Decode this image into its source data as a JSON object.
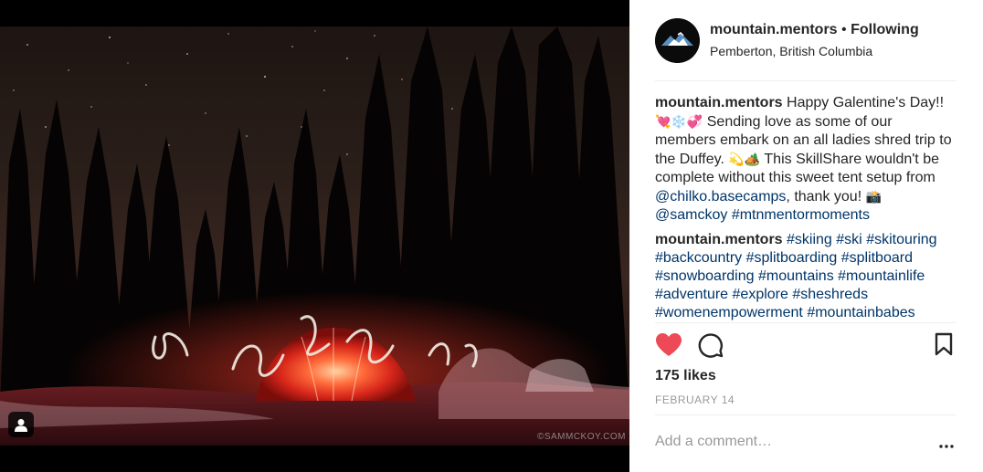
{
  "post": {
    "username": "mountain.mentors",
    "separator": "•",
    "follow_status": "Following",
    "location": "Pemberton, British Columbia",
    "photo_watermark": "©SAMMCKOY.COM"
  },
  "comments": [
    {
      "username": "mountain.mentors",
      "text_1": "Happy Galentine's Day!!",
      "emoji_1": "💘❄️💞",
      "text_2": "Sending love as some of our members embark on an all ladies shred trip to the Duffey.",
      "emoji_2": "💫🏕️",
      "text_3": "This SkillShare wouldn't be complete without this sweet tent setup from",
      "mention_1": "@chilko.basecamps",
      "text_4": ", thank you!",
      "emoji_3": "📸",
      "mention_2": "@samckoy",
      "hashtag_1": "#mtnmentormoments"
    },
    {
      "username": "mountain.mentors",
      "hashtags": [
        "#skiing",
        "#ski",
        "#skitouring",
        "#backcountry",
        "#splitboarding",
        "#splitboard",
        "#snowboarding",
        "#mountains",
        "#mountainlife",
        "#adventure",
        "#explore",
        "#sheshreds",
        "#womenempowerment",
        "#mountainbabes"
      ]
    }
  ],
  "stats": {
    "likes": "175 likes",
    "date": "FEBRUARY 14"
  },
  "comment_input": {
    "placeholder": "Add a comment…"
  },
  "icons": {
    "like": "heart-icon",
    "comment": "comment-icon",
    "save": "bookmark-icon",
    "more": "more-options-icon",
    "user_tag": "user-tag-icon"
  },
  "colors": {
    "like_red": "#ed4956",
    "link_blue": "#003569",
    "muted_gray": "#999999",
    "text": "#262626"
  }
}
